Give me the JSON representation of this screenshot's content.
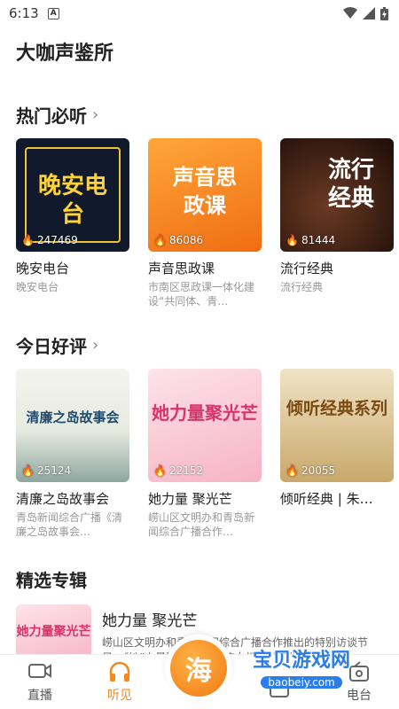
{
  "status": {
    "time": "6:13",
    "a_badge": "A"
  },
  "page": {
    "title": "大咖声鉴所"
  },
  "hot": {
    "title": "热门必听",
    "chevron": "›",
    "items": [
      {
        "title": "晚安电台",
        "sub": "晚安电台",
        "plays": "247469",
        "cover_text": "晚安电台"
      },
      {
        "title": "声音思政课",
        "sub": "市南区思政课一体化建设“共同体、青…",
        "plays": "86086",
        "cover_text": "声音思政课"
      },
      {
        "title": "流行经典",
        "sub": "流行经典",
        "plays": "81444",
        "cover_text": "流行经典"
      }
    ]
  },
  "today": {
    "title": "今日好评",
    "chevron": "›",
    "items": [
      {
        "title": "清廉之岛故事会",
        "sub": "青岛新闻综合广播《清廉之岛故事会…",
        "plays": "25124",
        "cover_text": "清廉之岛故事会"
      },
      {
        "title": "她力量 聚光芒",
        "sub": "崂山区文明办和青岛新闻综合广播合作…",
        "plays": "22152",
        "cover_text": "她力量聚光芒"
      },
      {
        "title": "倾听经典 | 朱…",
        "sub": "",
        "plays": "20055",
        "cover_text": "倾听经典系列"
      }
    ]
  },
  "albums": {
    "title": "精选专辑",
    "items": [
      {
        "title": "她力量 聚光芒",
        "desc": "崂山区文明办和青岛新闻综合广播合作推出的特别访谈节目：《她”力量聚光芒》，聚焦女性和儿童生…",
        "cover_text": "她力量聚光芒"
      }
    ]
  },
  "tabbar": {
    "tabs": [
      {
        "label": "直播",
        "icon": "video-icon"
      },
      {
        "label": "听见",
        "icon": "headphones-icon"
      },
      {
        "label": "",
        "icon": "center-logo"
      },
      {
        "label": "",
        "icon": "ticket-icon"
      },
      {
        "label": "电台",
        "icon": "radio-icon"
      }
    ],
    "center_char": "海"
  },
  "watermark": {
    "line1": "宝贝游戏网",
    "line2": "baobeiy.com"
  },
  "colors": {
    "accent": "#f08a1c",
    "watermark": "#2b7de9"
  }
}
